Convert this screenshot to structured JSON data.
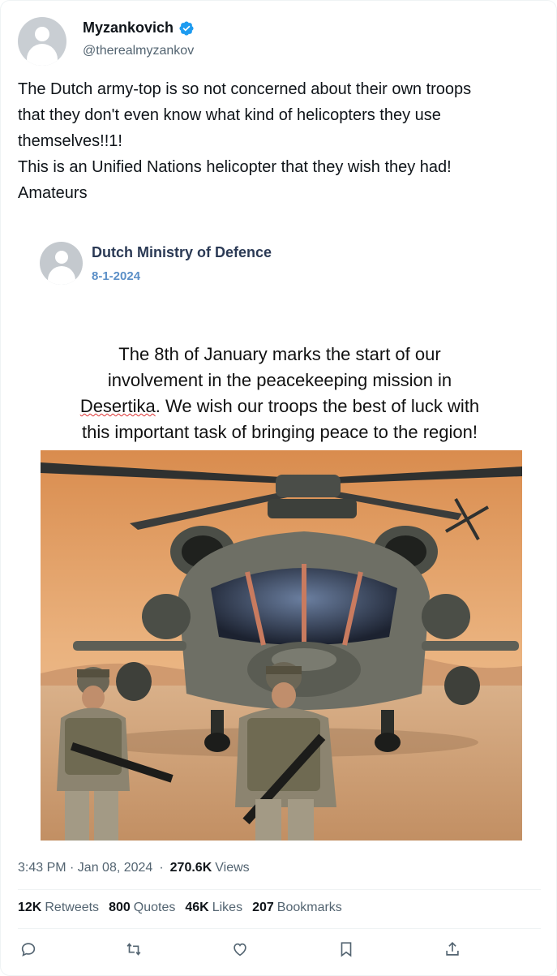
{
  "author": {
    "display_name": "Myzankovich",
    "handle": "@therealmyzankov",
    "verified": true
  },
  "tweet": {
    "lines": [
      "The Dutch army-top is so not concerned about their own troops",
      "that they don't even know what kind of helicopters they use",
      "themselves!!1!",
      "This is an Unified Nations helicopter that they wish they had!",
      "Amateurs"
    ]
  },
  "embedded_post": {
    "name": "Dutch Ministry of Defence",
    "date": "8-1-2024",
    "headline_lines": [
      "The 8th of January marks the start of our",
      "involvement in the peacekeeping mission in",
      "Desertika",
      ". We wish our troops the best of luck with",
      "this important task of bringing peace to the region!"
    ],
    "image_alt": "military helicopter with two soldiers in desert"
  },
  "meta": {
    "time": "3:43 PM · Jan 08, 2024",
    "separator": "·",
    "views_count": "270.6K",
    "views_label": "Views"
  },
  "stats": [
    {
      "count": "12K",
      "label": "Retweets"
    },
    {
      "count": "800",
      "label": "Quotes"
    },
    {
      "count": "46K",
      "label": "Likes"
    },
    {
      "count": "207",
      "label": "Bookmarks"
    }
  ],
  "actions": [
    {
      "icon": "reply-icon"
    },
    {
      "icon": "retweet-icon"
    },
    {
      "icon": "like-icon"
    },
    {
      "icon": "bookmark-icon"
    },
    {
      "icon": "share-icon"
    }
  ],
  "colors": {
    "text": "#0f1419",
    "secondary": "#536471",
    "verified": "#1d9bf0",
    "divider": "#eff3f4"
  }
}
